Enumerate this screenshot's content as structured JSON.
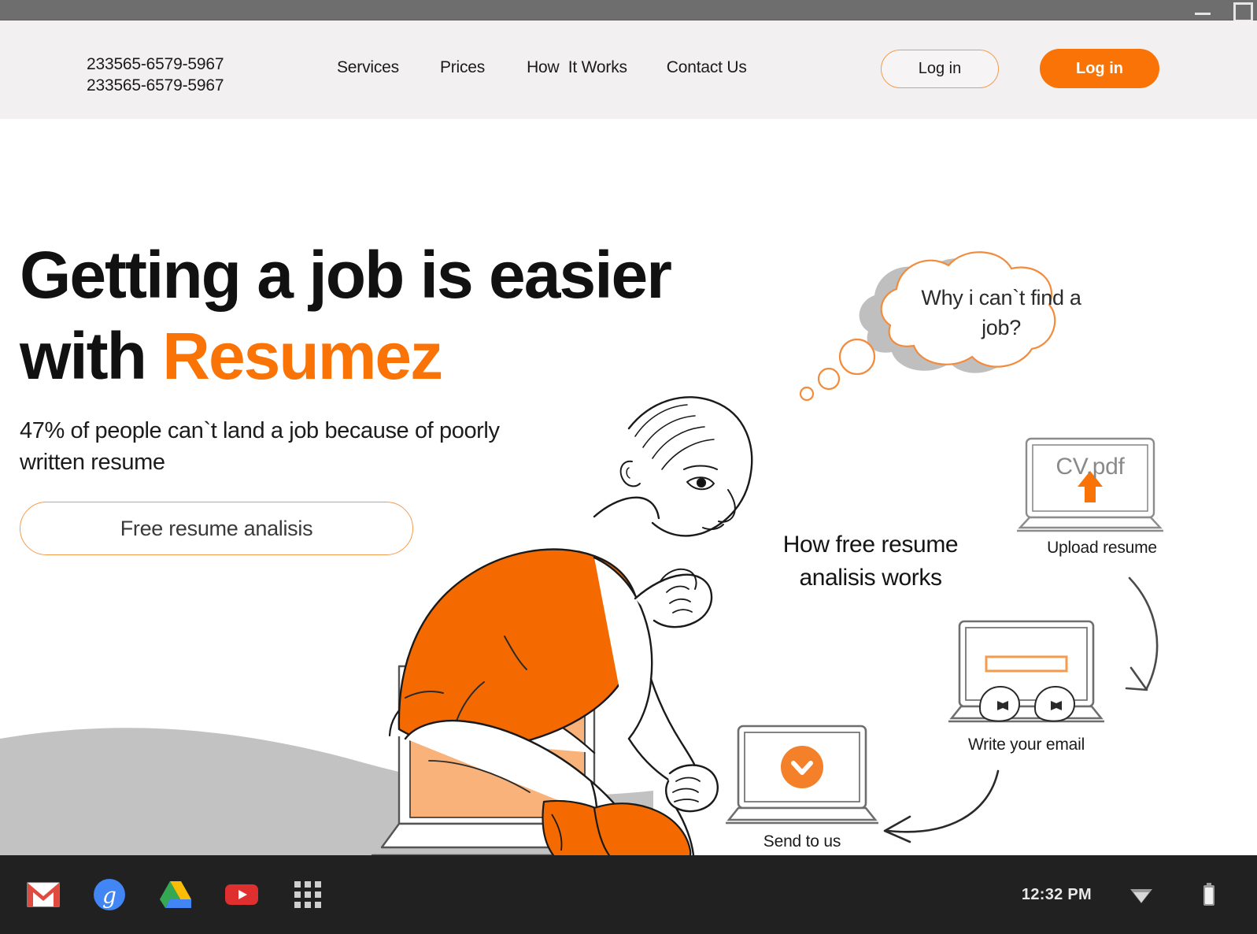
{
  "window": {
    "minimize_label": "minimize",
    "maximize_label": "maximize"
  },
  "header": {
    "phones": [
      "233565-6579-5967",
      "233565-6579-5967"
    ],
    "nav": [
      {
        "label": "Services"
      },
      {
        "label": "Prices"
      },
      {
        "label": "How  It Works"
      },
      {
        "label": "Contact Us"
      }
    ],
    "login_outline_label": "Log in",
    "login_filled_label": "Log in"
  },
  "hero": {
    "title_line1": "Getting a job is easier",
    "title_line2_prefix": "with ",
    "title_brand": "Resumez",
    "subtitle": "47% of people can`t land a job because of poorly written resume",
    "cta_label": "Free resume analisis"
  },
  "illustration": {
    "thought_bubble_text": "Why i can`t find a job?"
  },
  "flow": {
    "title": "How free resume analisis works",
    "steps": [
      {
        "id": "upload",
        "screen_text": "CV.pdf",
        "caption": "Upload resume"
      },
      {
        "id": "email",
        "screen_text": "",
        "caption": "Write your email"
      },
      {
        "id": "send",
        "screen_text": "",
        "caption": "Send to us"
      }
    ]
  },
  "shelf": {
    "apps": [
      {
        "name": "gmail-icon",
        "label": "Gmail"
      },
      {
        "name": "google-search-icon",
        "label": "Google"
      },
      {
        "name": "google-drive-icon",
        "label": "Google Drive"
      },
      {
        "name": "youtube-icon",
        "label": "YouTube"
      },
      {
        "name": "apps-grid-icon",
        "label": "All Apps"
      }
    ],
    "clock": "12:32 PM",
    "wifi_label": "Wi-Fi",
    "battery_label": "Battery"
  },
  "colors": {
    "accent_orange": "#f97306",
    "accent_light_orange": "#f59b4e",
    "header_bg": "#f2f0f0",
    "shelf_bg": "#212121",
    "hill_gray": "#c2c2c2",
    "titlebar_gray": "#6e6e6e"
  }
}
